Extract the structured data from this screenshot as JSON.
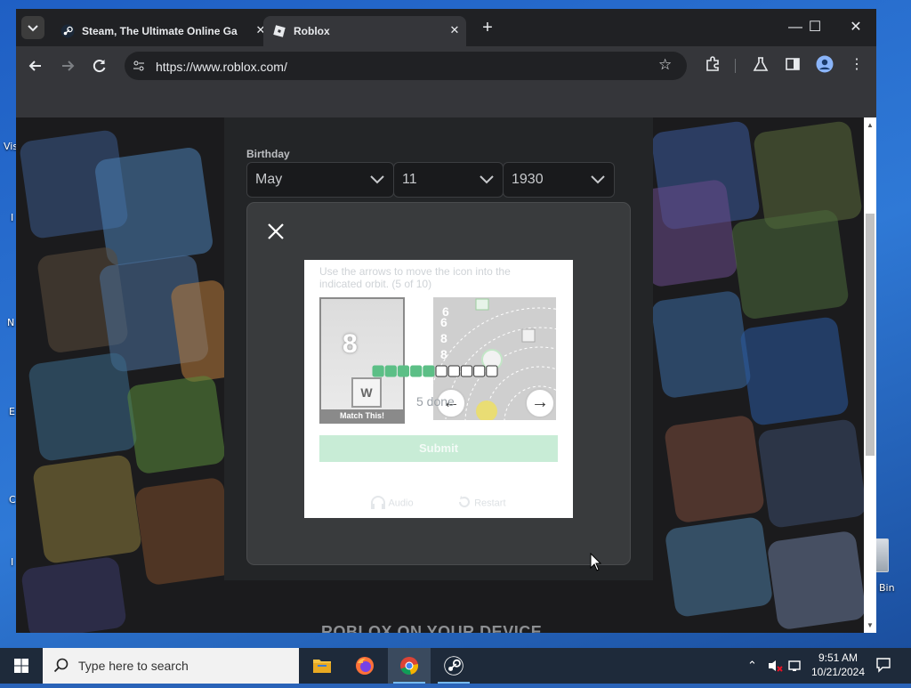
{
  "desktop": {
    "partial_labels": [
      "Vis",
      "I",
      "N",
      "E",
      "C",
      "I"
    ],
    "recycle_bin_label": "Bin"
  },
  "browser": {
    "tabs": [
      {
        "title": "Steam, The Ultimate Online Ga",
        "icon": "steam-icon",
        "active": false
      },
      {
        "title": "Roblox",
        "icon": "roblox-icon",
        "active": true
      }
    ],
    "url": "https://www.roblox.com/",
    "colors": {
      "frame": "#202124",
      "toolbar": "#35363a"
    }
  },
  "page": {
    "birthday_label": "Birthday",
    "birthday": {
      "month": "May",
      "day": "11",
      "year": "1930"
    },
    "footer_heading": "ROBLOX ON YOUR DEVICE"
  },
  "captcha": {
    "instruction": "Use the arrows to move the icon into the indicated orbit. (5 of 10)",
    "match_value": "8",
    "match_icon_letter": "W",
    "match_label": "Match This!",
    "right_numbers": [
      "6",
      "6",
      "8",
      "8"
    ],
    "progress_done": 5,
    "progress_total": 10,
    "done_text": "5 done",
    "submit_label": "Submit",
    "audio_label": "Audio",
    "restart_label": "Restart",
    "accent_color": "#5cbf86"
  },
  "taskbar": {
    "search_placeholder": "Type here to search",
    "apps": [
      "file-explorer-icon",
      "firefox-icon",
      "chrome-icon",
      "steam-icon"
    ],
    "active_app": "chrome-icon",
    "time": "9:51 AM",
    "date": "10/21/2024"
  }
}
